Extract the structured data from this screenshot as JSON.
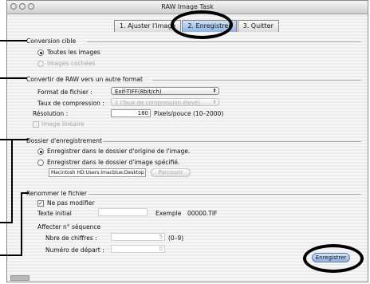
{
  "window": {
    "title": "RAW Image Task"
  },
  "tabs": [
    {
      "label": "1. Ajuster l'image"
    },
    {
      "label": "2. Enregistrer"
    },
    {
      "label": "3. Quitter"
    }
  ],
  "conversion": {
    "title": "Conversion cible",
    "opt_all": "Toutes les images",
    "opt_checked": "Images cochées"
  },
  "convert_raw": {
    "title": "Convertir de RAW vers un autre format",
    "format_label": "Format de fichier :",
    "format_value": "Exif-TIFF(8bit/ch)",
    "compression_label": "Taux de compression :",
    "compression_value": "1 (Taux de compression élevé)",
    "resolution_label": "Résolution :",
    "resolution_value": "180",
    "resolution_unit": "Pixels/pouce   (10–2000)",
    "linear_label": "Image linéaire"
  },
  "save_folder": {
    "title": "Dossier d'enregistrement",
    "opt_original": "Enregistrer dans le dossier d'origine de l'image.",
    "opt_specified": "Enregistrer dans le dossier d'image spécifié.",
    "path": "Macintosh HD:Users:imacblue:Desktop",
    "browse_label": "Parcourir"
  },
  "rename": {
    "title": "Renommer le fichier",
    "no_change_label": "Ne pas modifier",
    "initial_text_label": "Texte initial",
    "initial_text_value": "",
    "example_label": "Exemple",
    "example_value": "00000.TIF",
    "sequence_label": "Affecter n° séquence",
    "digits_label": "Nbre de chiffres :",
    "digits_value": "5",
    "digits_range": "(0–9)",
    "start_label": "Numéro de départ :",
    "start_value": "0"
  },
  "actions": {
    "save_label": "Enregistrer"
  }
}
